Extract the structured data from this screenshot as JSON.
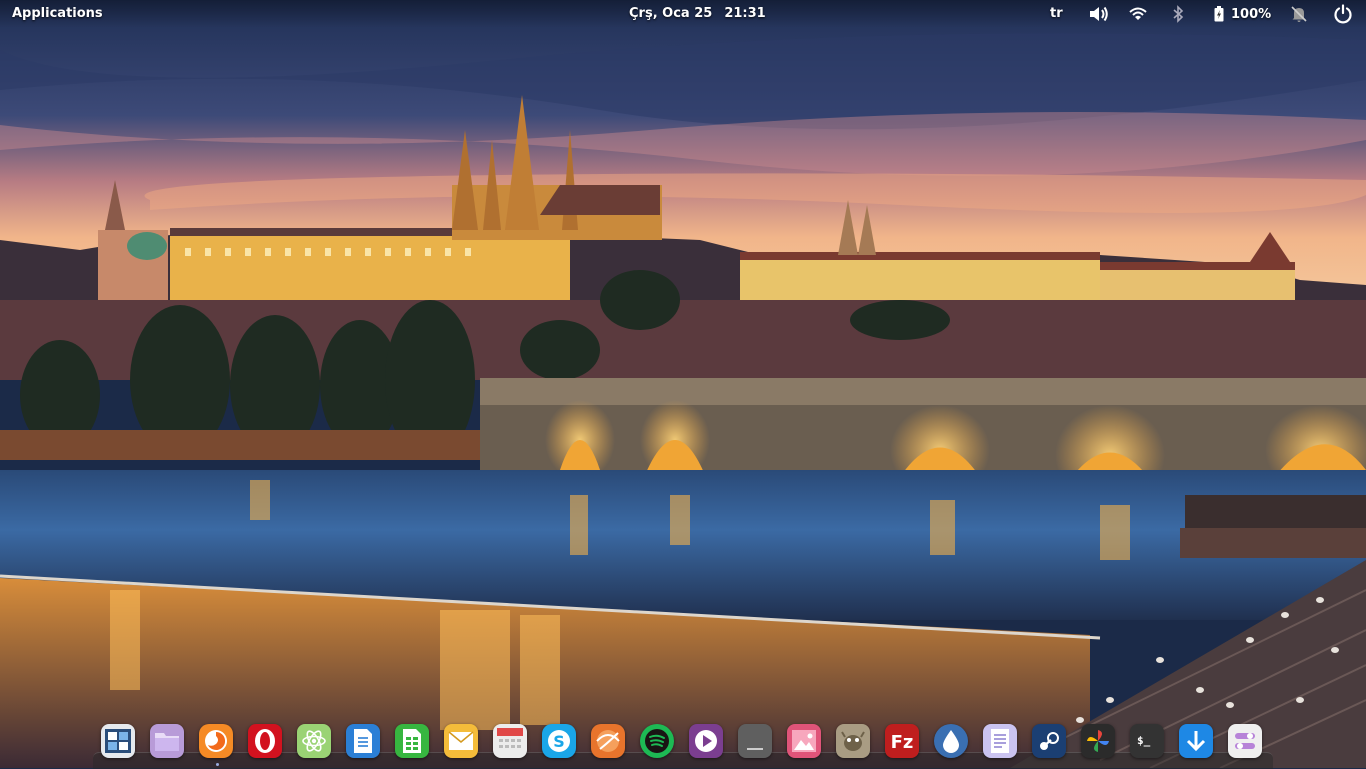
{
  "panel": {
    "applications_label": "Applications",
    "date": "Çrş, Oca 25",
    "time": "21:31",
    "keyboard_layout": "tr",
    "battery_percent": "100%"
  },
  "dock": {
    "items": [
      {
        "icon": "multitasking-view-icon",
        "color": "#d8dde4"
      },
      {
        "icon": "files-icon",
        "color": "#b79bd9"
      },
      {
        "icon": "firefox-icon",
        "color": "#f47b20"
      },
      {
        "icon": "opera-icon",
        "color": "#d11a24"
      },
      {
        "icon": "atom-icon",
        "color": "#8fd06a"
      },
      {
        "icon": "libreoffice-writer-icon",
        "color": "#2a7bd1"
      },
      {
        "icon": "libreoffice-calc-icon",
        "color": "#35b33e"
      },
      {
        "icon": "mail-icon",
        "color": "#f2b838"
      },
      {
        "icon": "calendar-icon",
        "color": "#e9e9e9"
      },
      {
        "icon": "skype-icon",
        "color": "#1aa4e6"
      },
      {
        "icon": "web-browser-icon",
        "color": "#e8722a"
      },
      {
        "icon": "spotify-icon",
        "color": "#1db954"
      },
      {
        "icon": "videos-icon",
        "color": "#7a3d8e"
      },
      {
        "icon": "terminal-gray-icon",
        "color": "#5d5d5d"
      },
      {
        "icon": "photos-icon",
        "color": "#e0507a"
      },
      {
        "icon": "gimp-icon",
        "color": "#a99a80"
      },
      {
        "icon": "filezilla-icon",
        "color": "#bf1e1e"
      },
      {
        "icon": "water-drop-icon",
        "color": "#3a6fb0"
      },
      {
        "icon": "text-editor-icon",
        "color": "#c9c2ef"
      },
      {
        "icon": "steam-icon",
        "color": "#1b3f73"
      },
      {
        "icon": "pinwheel-icon",
        "color": "#2b2b2b"
      },
      {
        "icon": "terminal-icon",
        "color": "#333333"
      },
      {
        "icon": "downloads-icon",
        "color": "#1e88e5"
      },
      {
        "icon": "switchboard-settings-icon",
        "color": "#ececec"
      }
    ]
  }
}
